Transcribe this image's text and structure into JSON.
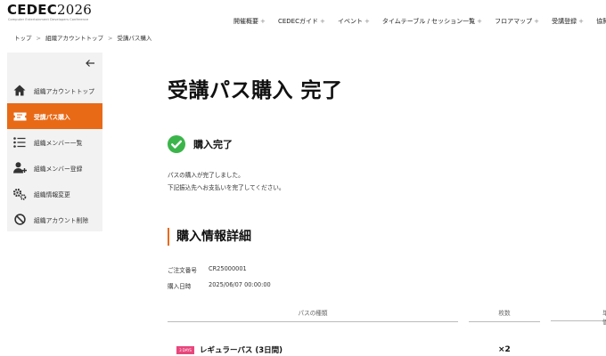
{
  "header": {
    "logo_text": "CEDEC",
    "logo_year": "2026",
    "logo_subtitle": "Computer Entertainment Developers Conference",
    "nav": [
      {
        "label": "開催概要",
        "icon": "plus-icon"
      },
      {
        "label": "CEDECガイド",
        "icon": "plus-icon"
      },
      {
        "label": "イベント",
        "icon": "plus-icon"
      },
      {
        "label": "タイムテーブル / セッション一覧",
        "icon": "plus-icon"
      },
      {
        "label": "フロアマップ",
        "icon": "plus-icon"
      },
      {
        "label": "受講登録",
        "icon": "plus-icon"
      },
      {
        "label": "協賛・スポ",
        "icon": "plus-icon"
      }
    ]
  },
  "breadcrumb": [
    "トップ",
    "組織アカウントトップ",
    "受講パス購入"
  ],
  "sidebar": {
    "back_icon": "arrow-left-icon",
    "items": [
      {
        "label": "組織アカウントトップ",
        "icon": "home-icon",
        "active": false
      },
      {
        "label": "受講パス購入",
        "icon": "ticket-icon",
        "active": true
      },
      {
        "label": "組織メンバー一覧",
        "icon": "list-icon",
        "active": false
      },
      {
        "label": "組織メンバー登録",
        "icon": "add-user-icon",
        "active": false
      },
      {
        "label": "組織情報変更",
        "icon": "gears-icon",
        "active": false
      },
      {
        "label": "組織アカウント削除",
        "icon": "prohibit-icon",
        "active": false
      }
    ]
  },
  "main": {
    "title": "受講パス購入 完了",
    "complete_label": "購入完了",
    "messages": [
      "パスの購入が完了しました。",
      "下記振込先へお支払いを完了してください。"
    ],
    "section_title": "購入情報詳細",
    "order": {
      "order_no_label": "ご注文番号",
      "order_no": "CR25000001",
      "date_label": "購入日時",
      "date": "2025/06/07 00:00:00"
    },
    "table": {
      "headers": [
        "パスの種類",
        "枚数",
        "単価"
      ],
      "rows": [
        {
          "badge": "3 DAYS",
          "name": "レギュラーパス (3日間)",
          "qty": "×2"
        }
      ]
    }
  },
  "colors": {
    "accent": "#e86a17",
    "check": "#3bb54a",
    "badge": "#e8467c",
    "sidebar_bg": "#f2f2f2"
  }
}
